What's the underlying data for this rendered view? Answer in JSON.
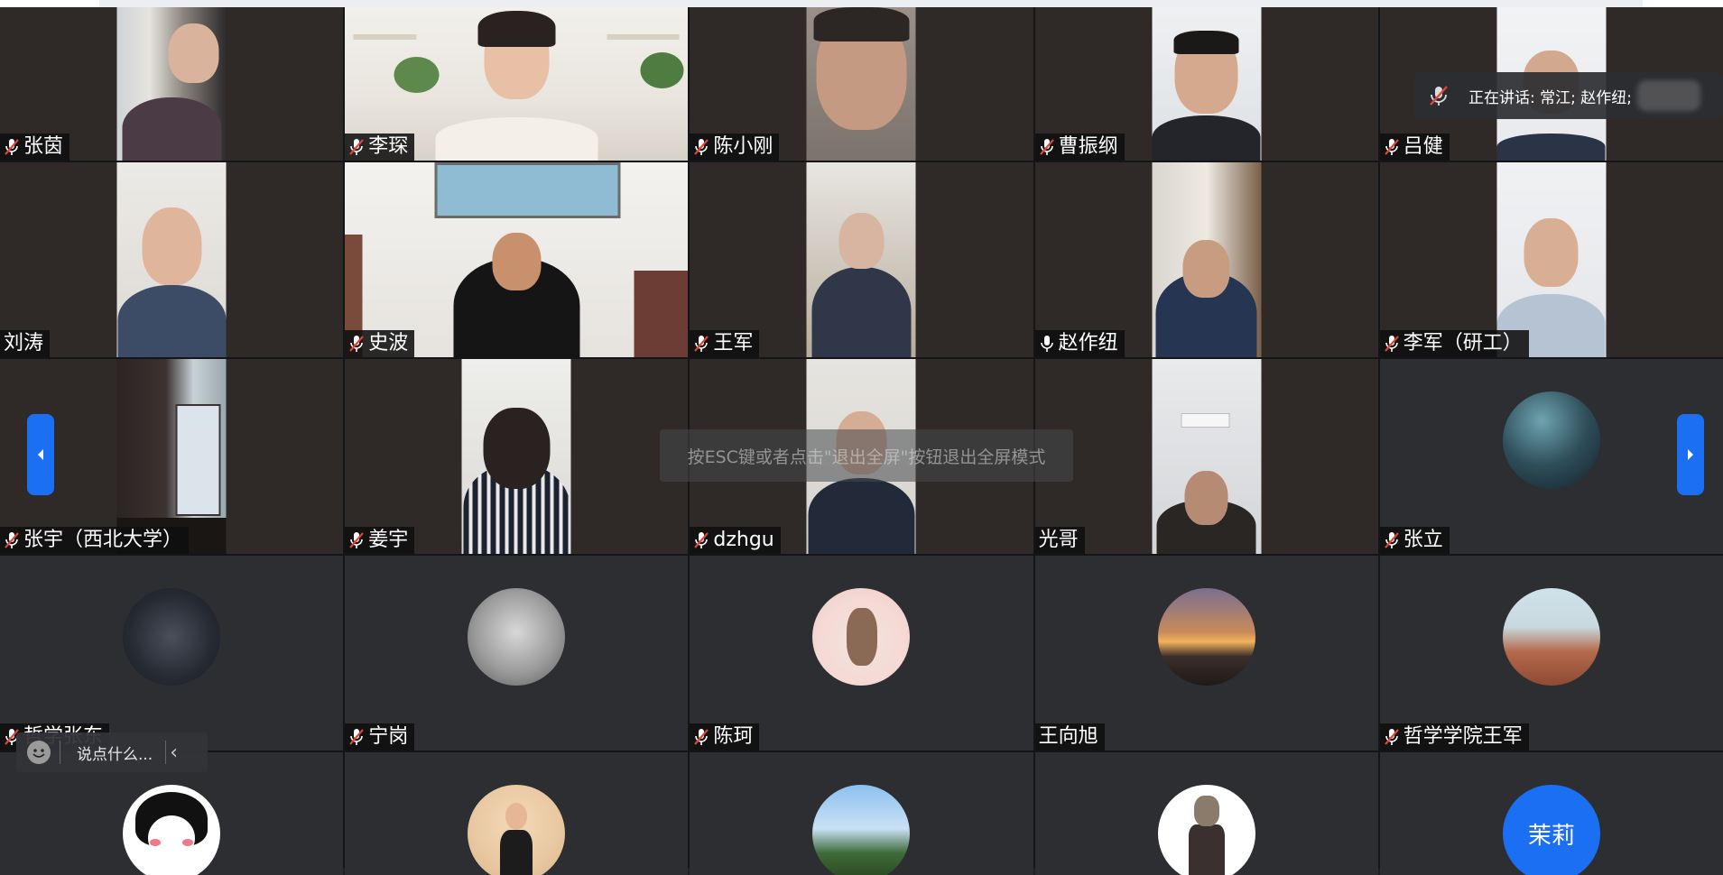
{
  "speaking": {
    "prefix": "正在讲话: ",
    "names": "常江; 赵作纽;"
  },
  "fullscreen_hint": "按ESC键或者点击\"退出全屏\"按钮退出全屏模式",
  "chat": {
    "placeholder": "说点什么..."
  },
  "nav": {
    "prev_icon": "chevron-left-icon",
    "next_icon": "chevron-right-icon"
  },
  "colors": {
    "accent": "#1b6ff2",
    "tile_bg": "#2c2e32",
    "mute_icon": "#e0453a",
    "label_bg": "#0f0f0f"
  },
  "participants": [
    {
      "name": "张茵",
      "mic": "muted"
    },
    {
      "name": "李琛",
      "mic": "muted"
    },
    {
      "name": "陈小刚",
      "mic": "muted"
    },
    {
      "name": "曹振纲",
      "mic": "muted"
    },
    {
      "name": "吕健",
      "mic": "muted"
    },
    {
      "name": "刘涛",
      "mic": "none"
    },
    {
      "name": "史波",
      "mic": "muted"
    },
    {
      "name": "王军",
      "mic": "muted"
    },
    {
      "name": "赵作纽",
      "mic": "on"
    },
    {
      "name": "李军（研工）",
      "mic": "muted"
    },
    {
      "name": "张宇（西北大学）",
      "mic": "muted"
    },
    {
      "name": "姜宇",
      "mic": "muted"
    },
    {
      "name": "dzhgu",
      "mic": "muted"
    },
    {
      "name": "光哥",
      "mic": "none"
    },
    {
      "name": "张立",
      "mic": "muted"
    },
    {
      "name": "哲学张东",
      "mic": "muted"
    },
    {
      "name": "宁岗",
      "mic": "muted"
    },
    {
      "name": "陈珂",
      "mic": "muted"
    },
    {
      "name": "王向旭",
      "mic": "none"
    },
    {
      "name": "哲学学院王军",
      "mic": "muted"
    },
    {
      "avatar_text": ""
    },
    {
      "avatar_text": ""
    },
    {
      "avatar_text": ""
    },
    {
      "avatar_text": ""
    },
    {
      "avatar_text": "茉莉"
    }
  ]
}
